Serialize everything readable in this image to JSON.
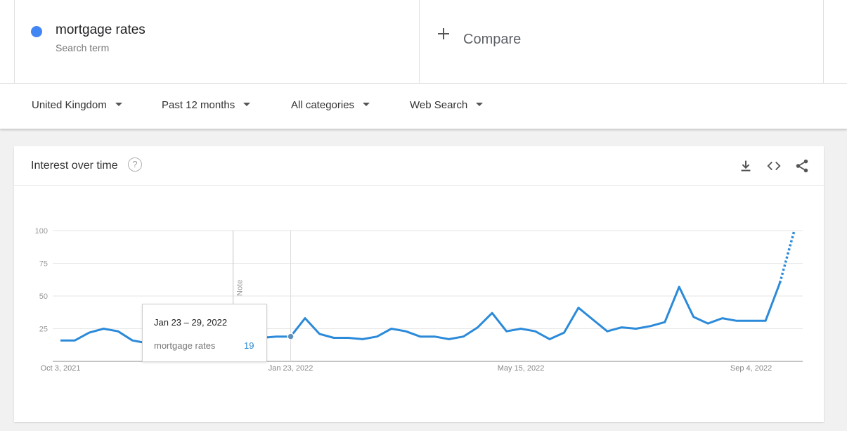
{
  "search_term": {
    "name": "mortgage rates",
    "subtitle": "Search term",
    "color": "#4285f4"
  },
  "compare": {
    "label": "Compare"
  },
  "filters": [
    {
      "label": "United Kingdom"
    },
    {
      "label": "Past 12 months"
    },
    {
      "label": "All categories"
    },
    {
      "label": "Web Search"
    }
  ],
  "card": {
    "title": "Interest over time",
    "help_icon": "?",
    "icons": [
      "download-icon",
      "embed-code-icon",
      "share-icon"
    ]
  },
  "tooltip": {
    "date": "Jan 23 – 29, 2022",
    "term": "mortgage rates",
    "value": "19"
  },
  "chart_data": {
    "type": "line",
    "series": [
      {
        "name": "mortgage rates",
        "color": "#2b8ad9",
        "values": [
          16,
          16,
          22,
          25,
          23,
          16,
          14,
          13,
          15,
          12,
          11,
          13,
          14,
          16,
          18,
          19,
          19,
          33,
          21,
          18,
          18,
          17,
          19,
          25,
          23,
          19,
          19,
          17,
          19,
          26,
          37,
          23,
          25,
          23,
          17,
          22,
          41,
          32,
          23,
          26,
          25,
          27,
          30,
          57,
          34,
          29,
          33,
          31,
          31,
          31,
          60,
          100
        ],
        "partial_from_index": 50
      }
    ],
    "x_ticks": [
      {
        "label": "Oct 3, 2021",
        "index": 0
      },
      {
        "label": "Jan 23, 2022",
        "index": 16
      },
      {
        "label": "May 15, 2022",
        "index": 32
      },
      {
        "label": "Sep 4, 2022",
        "index": 48
      }
    ],
    "y_ticks": [
      100,
      75,
      50,
      25
    ],
    "ylim": [
      0,
      100
    ],
    "grid": true,
    "highlight_index": 16,
    "note": {
      "label": "Note",
      "index": 12
    }
  }
}
